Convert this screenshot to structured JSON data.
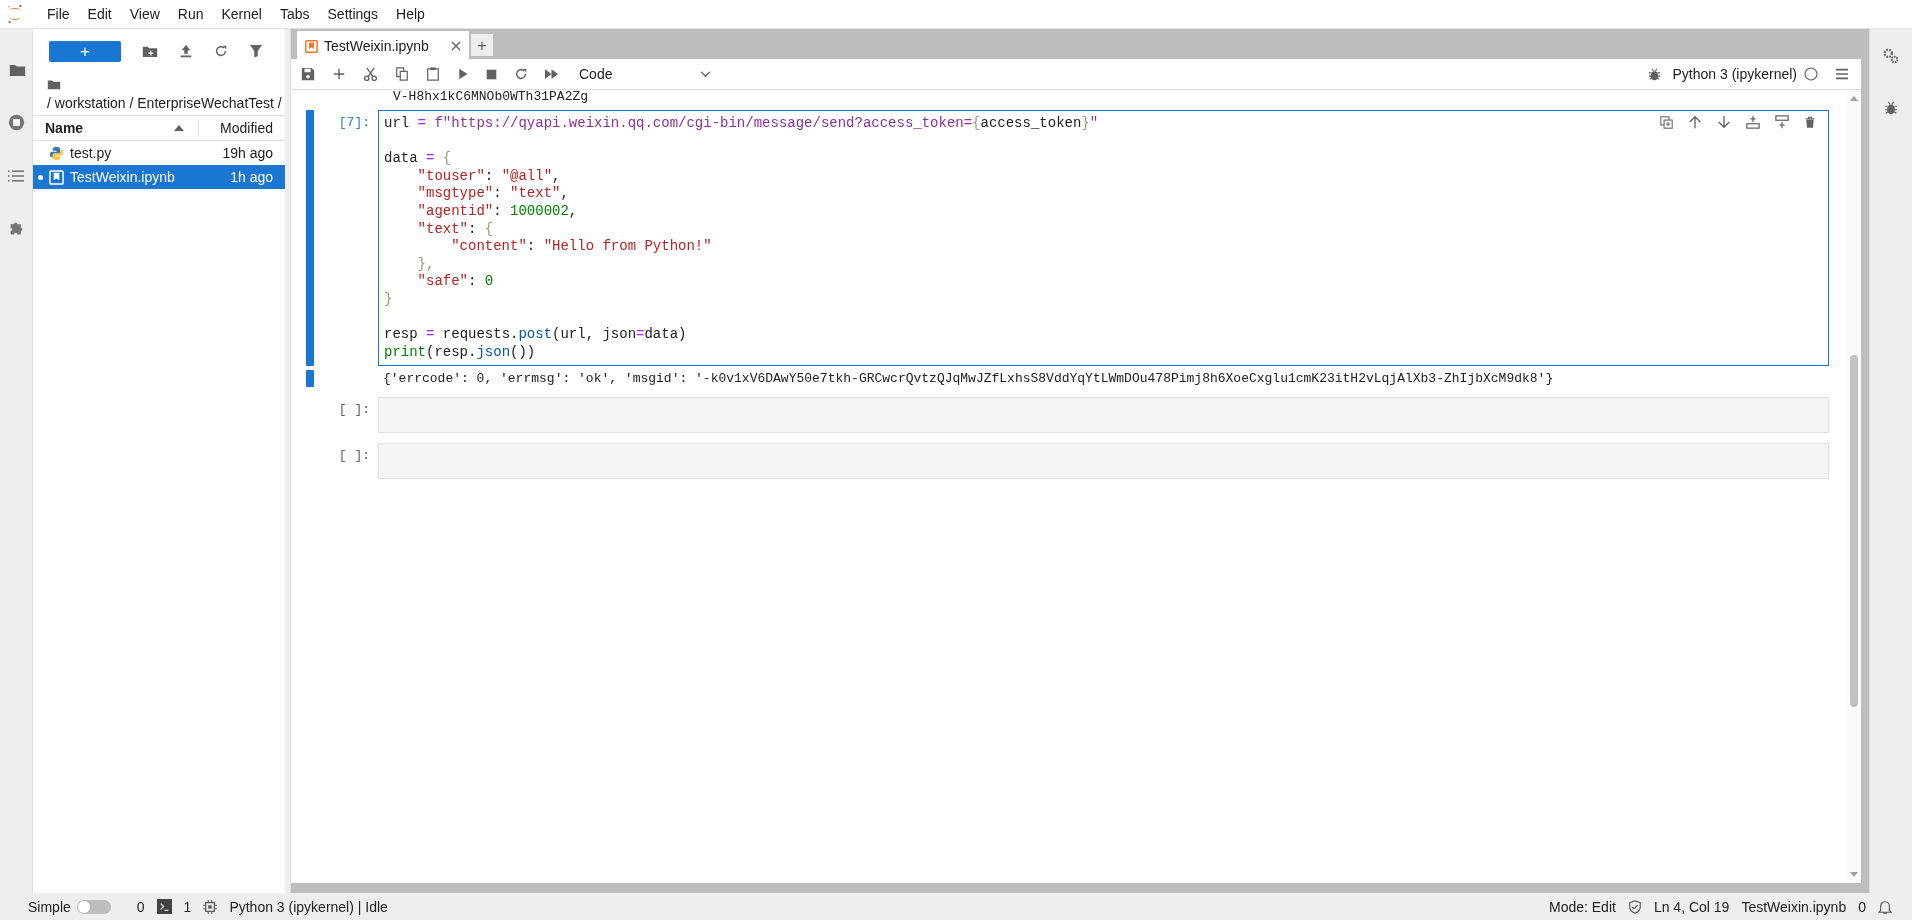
{
  "menu": [
    "File",
    "Edit",
    "View",
    "Run",
    "Kernel",
    "Tabs",
    "Settings",
    "Help"
  ],
  "left_tabs": [
    {
      "kind": "folder",
      "selected": true
    },
    {
      "kind": "running",
      "selected": false
    },
    {
      "kind": "toc",
      "selected": false
    },
    {
      "kind": "extensions",
      "selected": false
    }
  ],
  "file_browser": {
    "new_button": "+",
    "breadcrumb": "/ workstation / EnterpriseWechatTest /",
    "columns": [
      "Name",
      "Modified"
    ],
    "files": [
      {
        "name": "test.py",
        "modified": "19h ago",
        "kind": "python",
        "selected": false,
        "open": false
      },
      {
        "name": "TestWeixin.ipynb",
        "modified": "1h ago",
        "kind": "notebook",
        "selected": true,
        "open": true
      }
    ]
  },
  "tabs": [
    {
      "label": "TestWeixin.ipynb",
      "selected": true
    }
  ],
  "add_tab": "+",
  "notebook": {
    "cell_type": "Code",
    "kernel": "Python 3 (ipykernel)",
    "kernel_busy": false,
    "partial_output": "V-H8hx1kC6MNOb0WTh31PA2Zg",
    "cells": [
      {
        "prompt": "[7]:",
        "active": true,
        "lines": [
          {
            "kind": "code",
            "tokens": [
              {
                "text": "url ",
                "kind": "plain"
              },
              {
                "text": "= ",
                "kind": "operator"
              },
              {
                "text": "f\"https://qyapi.weixin.qq.com/cgi-bin/message/send?access_token=",
                "kind": "fstring"
              },
              {
                "text": "{",
                "kind": "bracket"
              },
              {
                "text": "access_token",
                "kind": "plain"
              },
              {
                "text": "}",
                "kind": "bracket"
              },
              {
                "text": "\"",
                "kind": "fstring"
              }
            ]
          },
          {
            "kind": "blank"
          },
          {
            "kind": "code",
            "tokens": [
              {
                "text": "data ",
                "kind": "plain"
              },
              {
                "text": "= ",
                "kind": "operator"
              },
              {
                "text": "{",
                "kind": "bracket"
              }
            ]
          },
          {
            "kind": "code",
            "tokens": [
              {
                "text": "    \"touser\"",
                "kind": "string"
              },
              {
                "text": ": ",
                "kind": "plain"
              },
              {
                "text": "\"@all\"",
                "kind": "string"
              },
              {
                "text": ",",
                "kind": "plain"
              }
            ]
          },
          {
            "kind": "code",
            "tokens": [
              {
                "text": "    \"msgtype\"",
                "kind": "string"
              },
              {
                "text": ": ",
                "kind": "plain"
              },
              {
                "text": "\"text\"",
                "kind": "string"
              },
              {
                "text": ",",
                "kind": "plain"
              }
            ]
          },
          {
            "kind": "code",
            "tokens": [
              {
                "text": "    \"agentid\"",
                "kind": "string"
              },
              {
                "text": ": ",
                "kind": "plain"
              },
              {
                "text": "1000002",
                "kind": "number"
              },
              {
                "text": ",",
                "kind": "plain"
              }
            ]
          },
          {
            "kind": "code",
            "tokens": [
              {
                "text": "    \"text\"",
                "kind": "string"
              },
              {
                "text": ": ",
                "kind": "plain"
              },
              {
                "text": "{",
                "kind": "bracket"
              }
            ]
          },
          {
            "kind": "code",
            "tokens": [
              {
                "text": "        \"content\"",
                "kind": "string"
              },
              {
                "text": ": ",
                "kind": "plain"
              },
              {
                "text": "\"Hello from Python!\"",
                "kind": "string"
              }
            ]
          },
          {
            "kind": "code",
            "tokens": [
              {
                "text": "    },",
                "kind": "bracket"
              }
            ]
          },
          {
            "kind": "code",
            "tokens": [
              {
                "text": "    \"safe\"",
                "kind": "string"
              },
              {
                "text": ": ",
                "kind": "plain"
              },
              {
                "text": "0",
                "kind": "number"
              }
            ]
          },
          {
            "kind": "code",
            "tokens": [
              {
                "text": "}",
                "kind": "bracket"
              }
            ]
          },
          {
            "kind": "blank"
          },
          {
            "kind": "code",
            "tokens": [
              {
                "text": "resp ",
                "kind": "plain"
              },
              {
                "text": "=",
                "kind": "operator"
              },
              {
                "text": " requests.",
                "kind": "plain"
              },
              {
                "text": "post",
                "kind": "property"
              },
              {
                "text": "(url, json",
                "kind": "plain"
              },
              {
                "text": "=",
                "kind": "operator"
              },
              {
                "text": "data)",
                "kind": "plain"
              }
            ]
          },
          {
            "kind": "code",
            "tokens": [
              {
                "text": "print",
                "kind": "builtin"
              },
              {
                "text": "(resp.",
                "kind": "plain"
              },
              {
                "text": "json",
                "kind": "property"
              },
              {
                "text": "())",
                "kind": "plain"
              }
            ]
          }
        ],
        "output": "{'errcode': 0, 'errmsg': 'ok', 'msgid': '-k0v1xV6DAwY50e7tkh-GRCwcrQvtzQJqMwJZfLxhsS8VddYqYtLWmDOu478Pimj8h6XoeCxglu1cmK23itH2vLqjAlXb3-ZhIjbXcM9dk8'}"
      },
      {
        "prompt": "[ ]:",
        "active": false
      },
      {
        "prompt": "[ ]:",
        "active": false
      }
    ]
  },
  "status_bar": {
    "mode_label": "Simple",
    "simple_mode": false,
    "terminals": "0",
    "kernels": "1",
    "kernel_status": "Python 3 (ipykernel) | Idle",
    "mode": "Mode: Edit",
    "position": "Ln 4, Col 19",
    "file": "TestWeixin.ipynb",
    "notifications": "0"
  }
}
